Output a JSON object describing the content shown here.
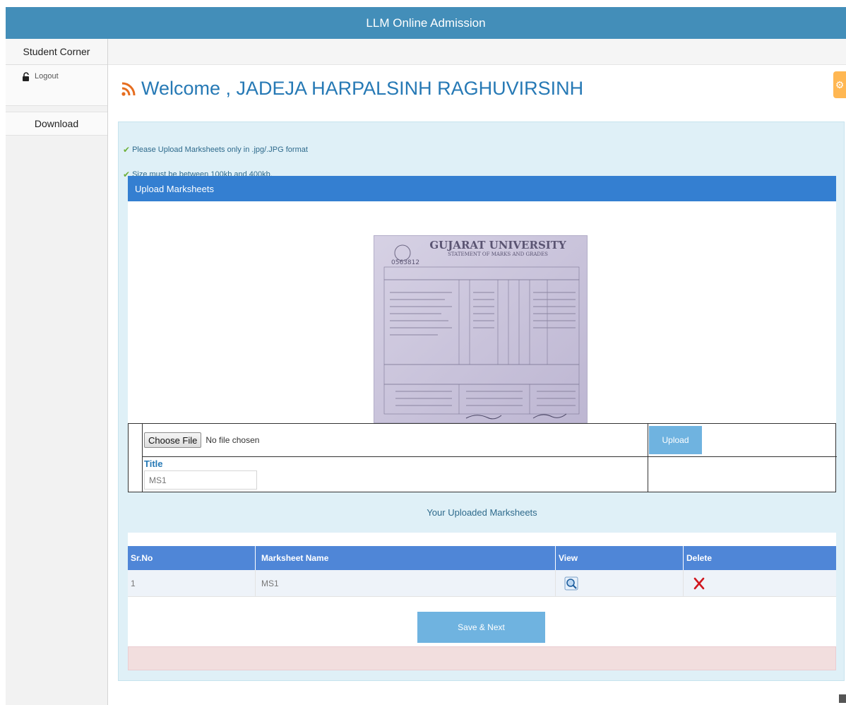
{
  "app": {
    "title": "LLM Online Admission"
  },
  "sidebar": {
    "title": "Student Corner",
    "logout_label": "Logout",
    "download_label": "Download"
  },
  "main": {
    "welcome": "Welcome , JADEJA HARPALSINH RAGHUVIRSINH",
    "notes": [
      "Please Upload Marksheets only in .jpg/.JPG format",
      "Size must be between 100kb and 400kb."
    ],
    "upload": {
      "header": "Upload Marksheets",
      "choose_file_label": "Choose File",
      "no_file_text": "No file chosen",
      "upload_button": "Upload",
      "title_label": "Title",
      "title_value": "MS1"
    },
    "marksheet_image": {
      "heading": "GUJARAT UNIVERSITY",
      "subheading": "STATEMENT OF MARKS AND GRADES",
      "number": "0563812"
    },
    "uploaded": {
      "heading": "Your Uploaded Marksheets",
      "columns": [
        "Sr.No",
        "Marksheet Name",
        "View",
        "Delete"
      ],
      "rows": [
        {
          "sr": "1",
          "name": "MS1"
        }
      ]
    },
    "save_button": "Save & Next"
  },
  "colors": {
    "topbar": "#438eb9",
    "welcome": "#2679b5",
    "panel_bg": "#dff0f7",
    "upload_header": "#347fd1",
    "table_header": "#4f86d7",
    "button": "#6fb3e0",
    "alert": "#f2dede",
    "gear_tab": "#ffb752"
  },
  "icons": {
    "logout": "lock-open-icon",
    "welcome": "rss-icon",
    "settings": "gear-icon",
    "view": "magnifier-icon",
    "delete": "close-x-icon",
    "note": "check-icon"
  }
}
